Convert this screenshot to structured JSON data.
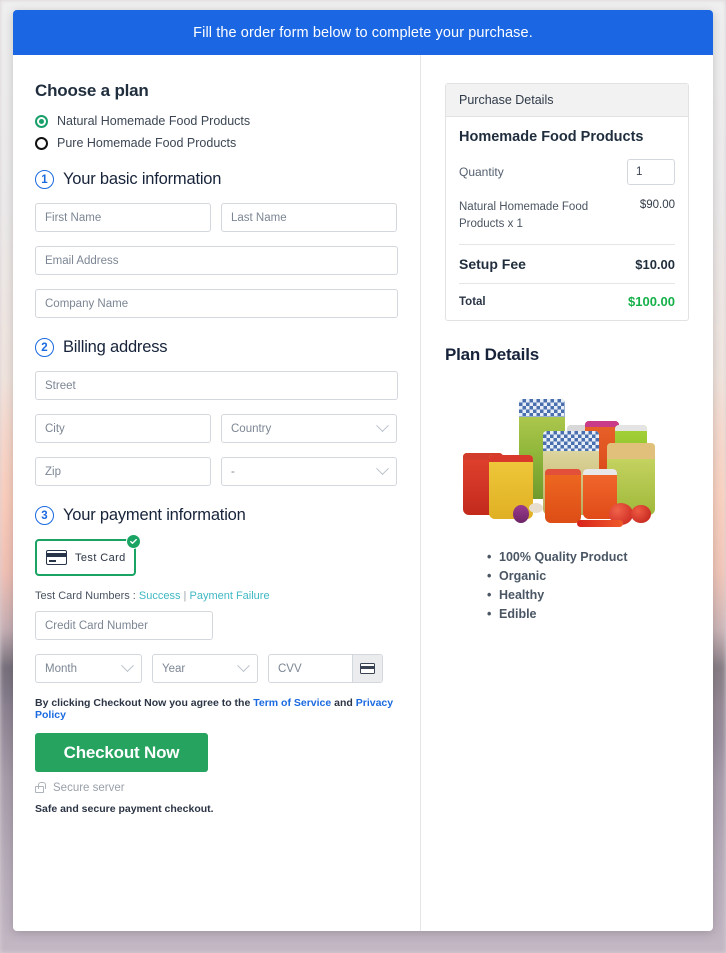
{
  "banner": {
    "text": "Fill the order form below to complete your purchase."
  },
  "plan": {
    "heading": "Choose a plan",
    "options": [
      {
        "label": "Natural Homemade Food Products",
        "selected": true
      },
      {
        "label": "Pure Homemade Food Products",
        "selected": false
      }
    ]
  },
  "steps": {
    "basic": {
      "number": "1",
      "title": "Your basic information"
    },
    "billing": {
      "number": "2",
      "title": "Billing address"
    },
    "payment": {
      "number": "3",
      "title": "Your payment information"
    }
  },
  "fields": {
    "first_name": "First Name",
    "last_name": "Last Name",
    "email": "Email Address",
    "company": "Company Name",
    "street": "Street",
    "city": "City",
    "country": "Country",
    "zip": "Zip",
    "state": "-",
    "credit_card": "Credit Card Number",
    "month": "Month",
    "year": "Year",
    "cvv": "CVV"
  },
  "payment": {
    "tile_label": "Test  Card",
    "test_cards_prefix": "Test Card Numbers : ",
    "success_link": "Success",
    "separator": " | ",
    "failure_link": "Payment Failure"
  },
  "terms": {
    "prefix": "By clicking Checkout Now you agree to the ",
    "tos": "Term of Service",
    "and": " and ",
    "privacy": "Privacy Policy"
  },
  "checkout": {
    "button_label": "Checkout Now",
    "secure_server": "Secure server",
    "safe_note": "Safe and secure payment checkout."
  },
  "purchase": {
    "panel_title": "Purchase Details",
    "product_title": "Homemade Food Products",
    "quantity_label": "Quantity",
    "quantity_value": "1",
    "line_item_name": "Natural Homemade Food Products x 1",
    "line_item_amount": "$90.00",
    "setup_fee_label": "Setup Fee",
    "setup_fee_amount": "$10.00",
    "total_label": "Total",
    "total_amount": "$100.00"
  },
  "plan_details": {
    "title": "Plan Details",
    "image_alt": "assorted-preserved-food-jars-photo",
    "features": [
      "100% Quality Product",
      "Organic",
      "Healthy",
      "Edible"
    ]
  },
  "colors": {
    "banner_blue": "#1a66e3",
    "step_blue": "#1a6ae0",
    "checkout_green": "#25a35f",
    "selected_green": "#1aa463",
    "total_green": "#16b04a",
    "link_teal": "#3fb8c4",
    "link_blue": "#1a6ae0"
  }
}
